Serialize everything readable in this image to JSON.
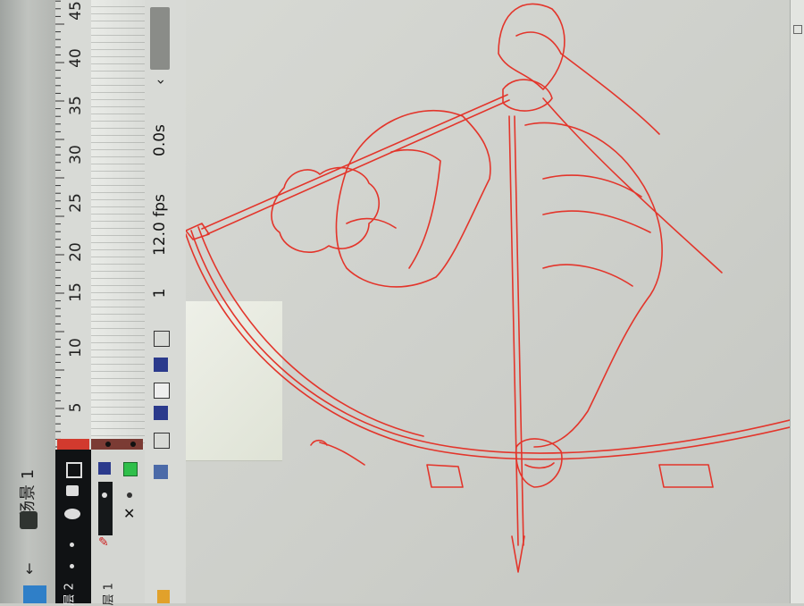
{
  "scene": {
    "label": "场景 1"
  },
  "timeline": {
    "ruler_ticks": [
      "5",
      "10",
      "15",
      "20",
      "25",
      "30",
      "35",
      "40",
      "45"
    ],
    "current_frame": "1",
    "fps": "12.0 fps",
    "elapsed": "0.0s",
    "scroll_arrow": "‹"
  },
  "layers": [
    {
      "label": "层 1"
    },
    {
      "label": "层 2"
    }
  ],
  "colors": {
    "stroke": "#e3352b",
    "playhead": "#d23a2e"
  },
  "icons": [
    "eye-icon",
    "lock-icon",
    "outline-icon",
    "pencil-icon",
    "x-icon",
    "trash-icon",
    "add-layer-icon",
    "onion-skin-icon",
    "center-frame-icon",
    "back-arrow-icon"
  ]
}
